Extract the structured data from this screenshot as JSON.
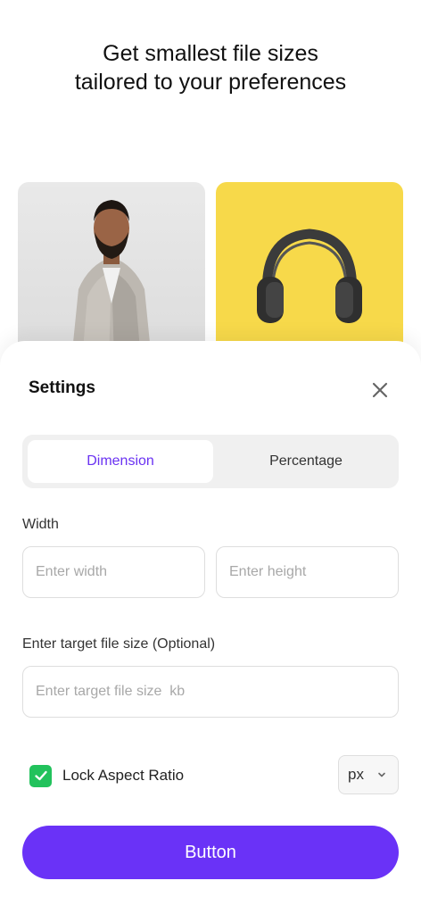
{
  "header": {
    "line1": "Get smallest file sizes",
    "line2": "tailored to your preferences"
  },
  "gallery": {
    "images": [
      {
        "subject": "man in grey suit portrait"
      },
      {
        "subject": "black headphones on yellow background"
      }
    ]
  },
  "settings": {
    "title": "Settings",
    "close_icon": "close-icon",
    "tabs": [
      {
        "label": "Dimension",
        "active": true
      },
      {
        "label": "Percentage",
        "active": false
      }
    ],
    "width_label": "Width",
    "width_placeholder": "Enter width",
    "height_placeholder": "Enter height",
    "target_label": "Enter target file size (Optional)",
    "target_placeholder": "Enter target file size  kb",
    "lock_aspect_label": "Lock Aspect Ratio",
    "lock_aspect_checked": true,
    "unit_selected": "px",
    "button_label": "Button"
  },
  "colors": {
    "accent": "#6a32f7",
    "checkbox": "#22c25c",
    "headphones_bg": "#f7d94a"
  }
}
